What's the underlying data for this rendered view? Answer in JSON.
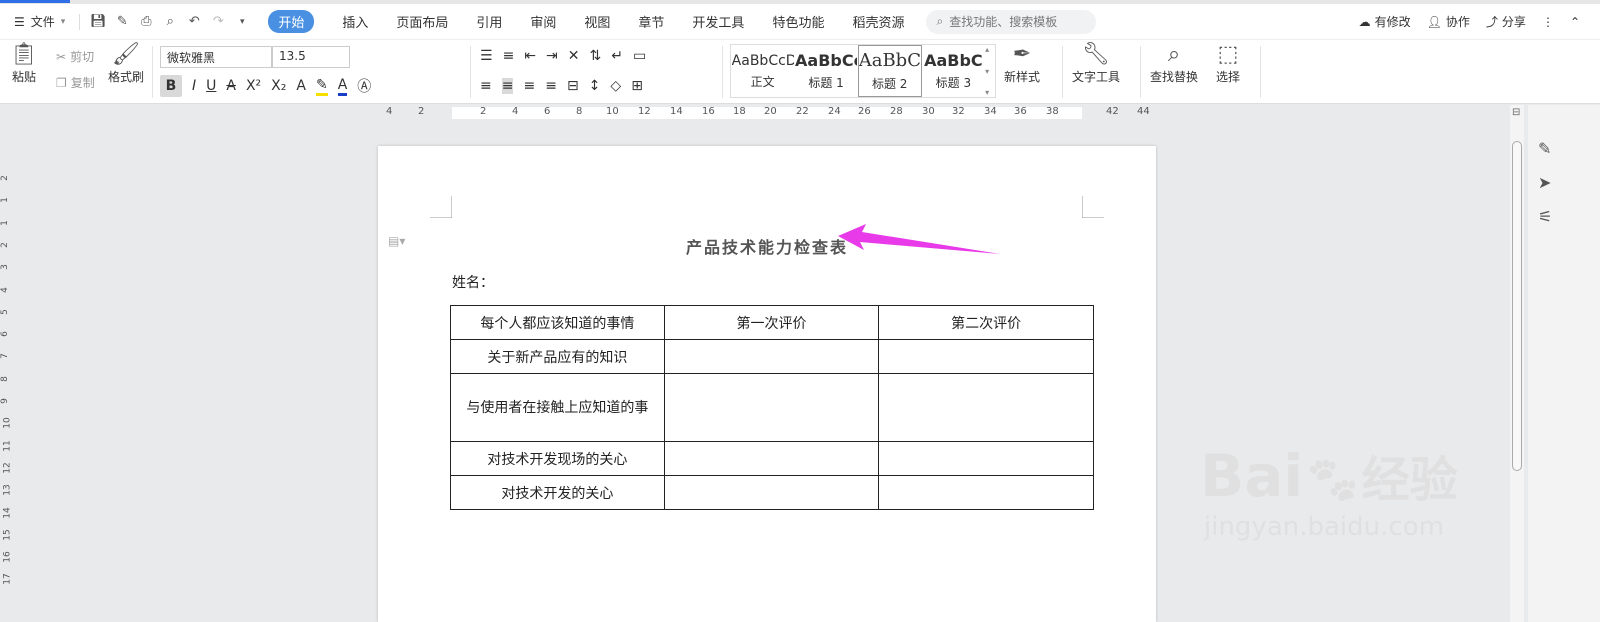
{
  "menubar": {
    "file_label": "文件",
    "tabs": [
      "开始",
      "插入",
      "页面布局",
      "引用",
      "审阅",
      "视图",
      "章节",
      "开发工具",
      "特色功能",
      "稻壳资源"
    ],
    "active_tab": "开始",
    "search_placeholder": "查找功能、搜索模板",
    "right": {
      "modified": "有修改",
      "collab": "协作",
      "share": "分享"
    }
  },
  "ribbon": {
    "paste": "粘贴",
    "cut": "剪切",
    "copy": "复制",
    "format_painter": "格式刷",
    "font_name": "微软雅黑",
    "font_size": "13.5",
    "styles": [
      {
        "preview": "AaBbCcD",
        "name": "正文"
      },
      {
        "preview": "AaBbCc",
        "name": "标题 1"
      },
      {
        "preview": "AaBbC",
        "name": "标题 2"
      },
      {
        "preview": "AaBbC",
        "name": "标题 3"
      }
    ],
    "new_style": "新样式",
    "text_tool": "文字工具",
    "find_replace": "查找替换",
    "select": "选择"
  },
  "ruler": {
    "h_ticks": [
      "4",
      "2",
      "2",
      "4",
      "6",
      "8",
      "10",
      "12",
      "14",
      "16",
      "18",
      "20",
      "22",
      "24",
      "26",
      "28",
      "30",
      "32",
      "34",
      "36",
      "38",
      "42",
      "44"
    ],
    "v_ticks": [
      "2",
      "1",
      "1",
      "2",
      "3",
      "4",
      "5",
      "6",
      "7",
      "8",
      "9",
      "10",
      "11",
      "12",
      "13",
      "14",
      "15",
      "16",
      "17"
    ]
  },
  "document": {
    "title": "产品技术能力检查表",
    "name_label": "姓名：",
    "table": {
      "headers": [
        "每个人都应该知道的事情",
        "第一次评价",
        "第二次评价"
      ],
      "rows": [
        [
          "关于新产品应有的知识",
          "",
          ""
        ],
        [
          "与使用者在接触上应知道的事",
          "",
          ""
        ],
        [
          "对技术开发现场的关心",
          "",
          ""
        ],
        [
          "对技术开发的关心",
          "",
          ""
        ]
      ]
    }
  },
  "watermark": {
    "brand": "Bai",
    "brand_cn": "经验",
    "url": "jingyan.baidu.com"
  },
  "colors": {
    "accent": "#4a90e2",
    "arrow": "#e83ae8"
  }
}
